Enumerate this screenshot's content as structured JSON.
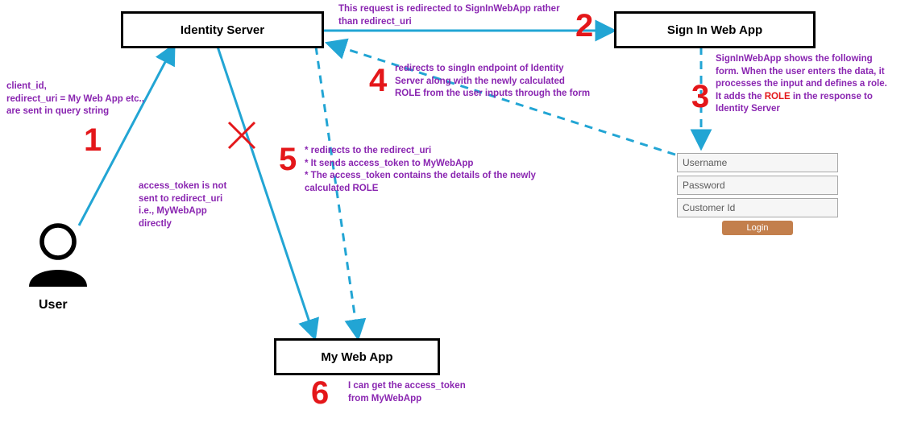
{
  "nodes": {
    "identity_server": "Identity Server",
    "signin_webapp": "Sign In Web App",
    "my_webapp": "My Web App",
    "user": "User"
  },
  "steps": {
    "n1": "1",
    "n2": "2",
    "n3": "3",
    "n4": "4",
    "n5": "5",
    "n6": "6"
  },
  "annotations": {
    "a1": "client_id,\nredirect_uri = My Web App etc.,\nare sent in query string",
    "x": "access_token is not\nsent to redirect_uri\ni.e., MyWebApp\ndirectly",
    "a2": "This request is redirected to SignInWebApp rather\nthan redirect_uri",
    "a3_pre": "SignInWebApp shows the following\nform. When the user enters the data, it\nprocesses the input and defines a role.\nIt adds the ",
    "a3_role": "ROLE",
    "a3_post": " in the response to\nIdentity Server",
    "a4": "redirects to singIn endpoint of Identity\nServer along with the newly calculated\nROLE from the user inputs through the form",
    "a5": "* redirects to the redirect_uri\n* It sends access_token to MyWebApp\n* The access_token contains the details of the newly\ncalculated ROLE",
    "a6": "I can get the access_token\nfrom MyWebApp"
  },
  "form": {
    "username": "Username",
    "password": "Password",
    "customer": "Customer Id",
    "login": "Login"
  }
}
